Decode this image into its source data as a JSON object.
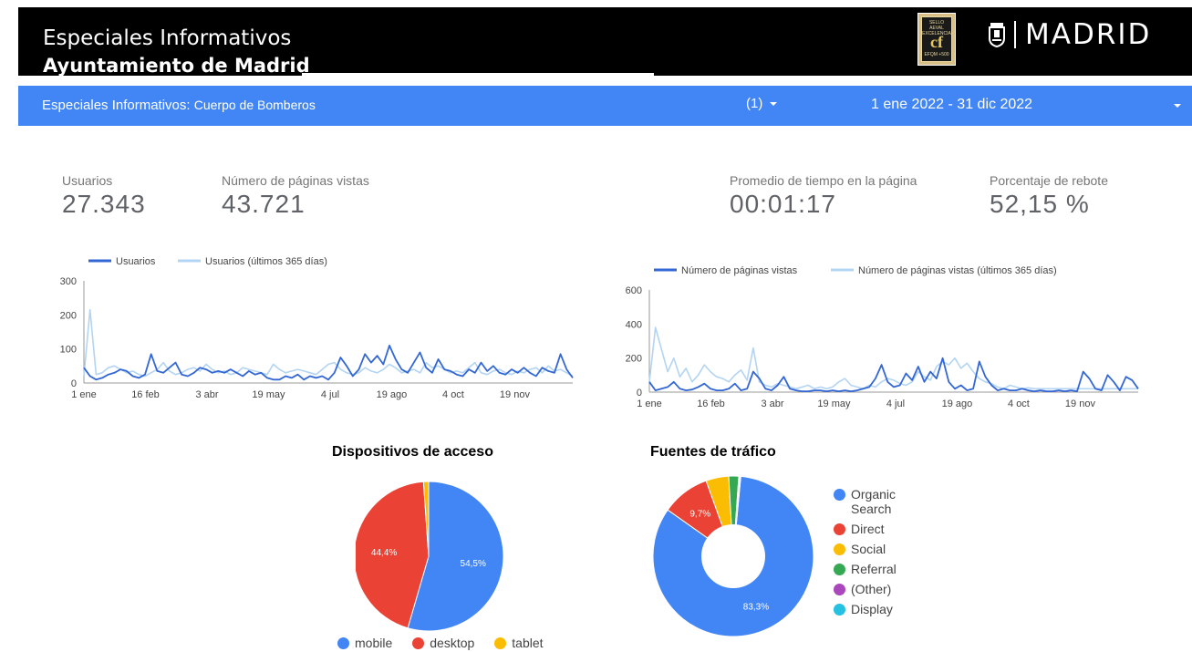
{
  "header": {
    "title_line1": "Especiales Informativos",
    "title_line2": "Ayuntamiento de Madrid",
    "seal_text": "SELLO AEVAL EXCELENCIA EFQM +500",
    "brand": "MADRID"
  },
  "filter_bar": {
    "title_prefix": "Especiales Informativos:",
    "title_suffix": "Cuerpo de Bomberos",
    "filter_label": "(1)",
    "date_range": "1 ene 2022 - 31 dic 2022"
  },
  "kpis": [
    {
      "label": "Usuarios",
      "value": "27.343"
    },
    {
      "label": "Número de páginas vistas",
      "value": "43.721"
    },
    {
      "label": "Promedio de tiempo en la página",
      "value": "00:01:17"
    },
    {
      "label": "Porcentaje de rebote",
      "value": "52,15 %"
    }
  ],
  "colors": {
    "accent": "#4285f4",
    "current_series": "#3367d6",
    "previous_series": "#b3d4f2",
    "mobile": "#4285f4",
    "desktop": "#ea4335",
    "tablet": "#fbbc04",
    "organic": "#4285f4",
    "direct": "#ea4335",
    "social": "#fbbc04",
    "referral": "#34a853",
    "other": "#ab47bc",
    "display": "#24c1e0"
  },
  "chart_data": [
    {
      "type": "line",
      "x_ticks": [
        "1 ene",
        "16 feb",
        "3 abr",
        "19 may",
        "4 jul",
        "19 ago",
        "4 oct",
        "19 nov"
      ],
      "ylim": [
        0,
        300
      ],
      "y_ticks": [
        "0",
        "100",
        "200",
        "300"
      ],
      "series": [
        {
          "name": "Usuarios",
          "values": [
            45,
            20,
            10,
            15,
            25,
            30,
            40,
            35,
            20,
            15,
            25,
            85,
            35,
            30,
            45,
            60,
            25,
            20,
            30,
            45,
            40,
            30,
            35,
            30,
            40,
            30,
            20,
            35,
            25,
            30,
            15,
            10,
            10,
            20,
            15,
            25,
            10,
            20,
            15,
            20,
            10,
            30,
            75,
            50,
            20,
            40,
            85,
            60,
            80,
            55,
            110,
            70,
            40,
            30,
            60,
            90,
            45,
            30,
            70,
            40,
            35,
            25,
            20,
            40,
            30,
            60,
            35,
            50,
            30,
            25,
            40,
            30,
            45,
            30,
            20,
            45,
            35,
            30,
            85,
            40,
            15
          ]
        },
        {
          "name": "Usuarios (últimos 365 días)",
          "values": [
            20,
            215,
            25,
            30,
            45,
            50,
            40,
            30,
            35,
            25,
            20,
            30,
            40,
            60,
            35,
            25,
            30,
            40,
            45,
            35,
            55,
            40,
            30,
            35,
            25,
            30,
            45,
            40,
            35,
            30,
            25,
            55,
            40,
            30,
            35,
            40,
            35,
            30,
            25,
            40,
            55,
            60,
            40,
            30,
            25,
            30,
            45,
            35,
            30,
            40,
            55,
            45,
            30,
            35,
            40,
            30,
            60,
            45,
            50,
            40,
            30,
            35,
            30,
            45,
            60,
            30,
            25,
            35,
            40,
            30,
            25,
            35,
            30,
            40,
            45,
            30,
            50,
            35,
            40,
            30,
            20
          ]
        }
      ]
    },
    {
      "type": "line",
      "x_ticks": [
        "1 ene",
        "16 feb",
        "3 abr",
        "19 may",
        "4 jul",
        "19 ago",
        "4 oct",
        "19 nov"
      ],
      "ylim": [
        0,
        600
      ],
      "y_ticks": [
        "0",
        "200",
        "400",
        "600"
      ],
      "series": [
        {
          "name": "Número de páginas vistas",
          "values": [
            60,
            10,
            20,
            30,
            60,
            20,
            10,
            15,
            30,
            50,
            20,
            10,
            10,
            20,
            50,
            10,
            20,
            120,
            80,
            20,
            10,
            40,
            90,
            20,
            10,
            5,
            5,
            10,
            10,
            5,
            10,
            5,
            10,
            5,
            10,
            20,
            30,
            80,
            160,
            60,
            30,
            40,
            110,
            70,
            150,
            60,
            120,
            80,
            200,
            60,
            20,
            40,
            10,
            20,
            180,
            90,
            40,
            10,
            20,
            10,
            10,
            20,
            10,
            5,
            10,
            5,
            5,
            10,
            5,
            10,
            5,
            120,
            80,
            20,
            10,
            100,
            60,
            10,
            90,
            70,
            20
          ]
        },
        {
          "name": "Número de páginas vistas (últimos 365 días)",
          "values": [
            60,
            380,
            250,
            120,
            200,
            90,
            140,
            60,
            100,
            160,
            120,
            90,
            80,
            60,
            100,
            130,
            70,
            260,
            60,
            40,
            30,
            50,
            40,
            30,
            20,
            30,
            40,
            20,
            30,
            20,
            30,
            60,
            80,
            40,
            30,
            20,
            40,
            30,
            60,
            80,
            70,
            50,
            40,
            60,
            120,
            90,
            70,
            150,
            180,
            160,
            200,
            140,
            170,
            120,
            80,
            60,
            50,
            30,
            20,
            40,
            30,
            20,
            25,
            20,
            20,
            20,
            20,
            20,
            20,
            20,
            20,
            20,
            20,
            20,
            20,
            20,
            20,
            20,
            20,
            20,
            20
          ]
        }
      ]
    },
    {
      "type": "pie",
      "title": "Dispositivos de acceso",
      "labels": [
        "mobile",
        "desktop",
        "tablet"
      ],
      "values": [
        54.5,
        44.4,
        1.1
      ],
      "data_labels": [
        "54,5%",
        "44,4%",
        ""
      ]
    },
    {
      "type": "pie",
      "title": "Fuentes de tráfico",
      "labels": [
        "Organic Search",
        "Direct",
        "Social",
        "Referral",
        "(Other)",
        "Display"
      ],
      "values": [
        83.3,
        9.7,
        4.6,
        2.0,
        0.2,
        0.2
      ],
      "data_labels": [
        "83,3%",
        "9,7%",
        "",
        "",
        "",
        ""
      ],
      "donut": true
    }
  ]
}
